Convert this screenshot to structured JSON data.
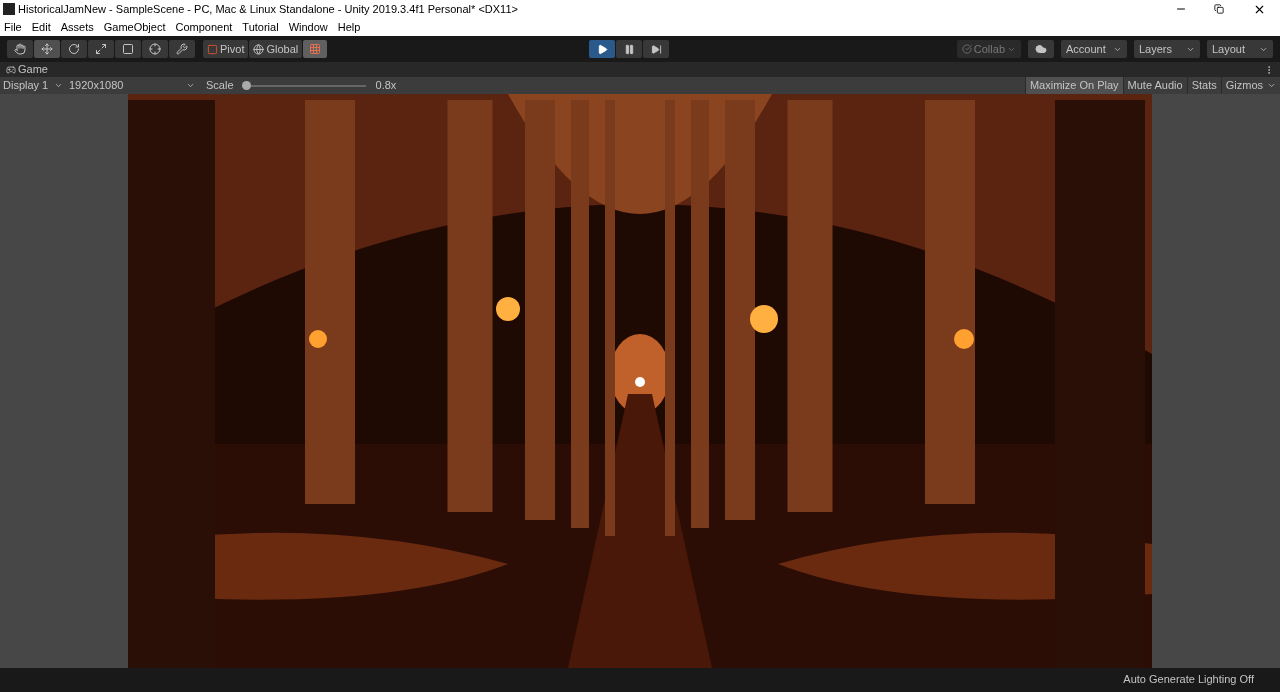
{
  "window": {
    "title": "HistoricalJamNew - SampleScene - PC, Mac & Linux Standalone - Unity 2019.3.4f1 Personal* <DX11>"
  },
  "menu": [
    "File",
    "Edit",
    "Assets",
    "GameObject",
    "Component",
    "Tutorial",
    "Window",
    "Help"
  ],
  "tools": [
    {
      "kind": "hand",
      "selected": false
    },
    {
      "kind": "move",
      "selected": true
    },
    {
      "kind": "rotate",
      "selected": false
    },
    {
      "kind": "scale",
      "selected": false
    },
    {
      "kind": "rect",
      "selected": false
    },
    {
      "kind": "transform",
      "selected": false
    },
    {
      "kind": "custom",
      "selected": false
    }
  ],
  "handles": [
    {
      "kind": "pivot",
      "label": "Pivot"
    },
    {
      "kind": "global",
      "label": "Global"
    }
  ],
  "grid_snap": {
    "on": true
  },
  "playback": [
    {
      "kind": "play",
      "selected": true
    },
    {
      "kind": "pause",
      "selected": false
    },
    {
      "kind": "step",
      "selected": false
    }
  ],
  "collab": {
    "label": "Collab",
    "disabled": true
  },
  "dropdowns": [
    "Account",
    "Layers",
    "Layout"
  ],
  "panel_tab": {
    "label": "Game"
  },
  "game_bar": {
    "display": "Display 1",
    "resolution": "1920x1080",
    "scale_label": "Scale",
    "scale": {
      "level": 0.0
    },
    "scale_reading": "0.8x",
    "toggles": [
      {
        "label": "Maximize On Play",
        "on": true
      },
      {
        "label": "Mute Audio",
        "on": false
      },
      {
        "label": "Stats",
        "on": false
      }
    ],
    "gizmos": "Gizmos"
  },
  "status_bar": {
    "text": "Auto Generate Lighting Off"
  }
}
